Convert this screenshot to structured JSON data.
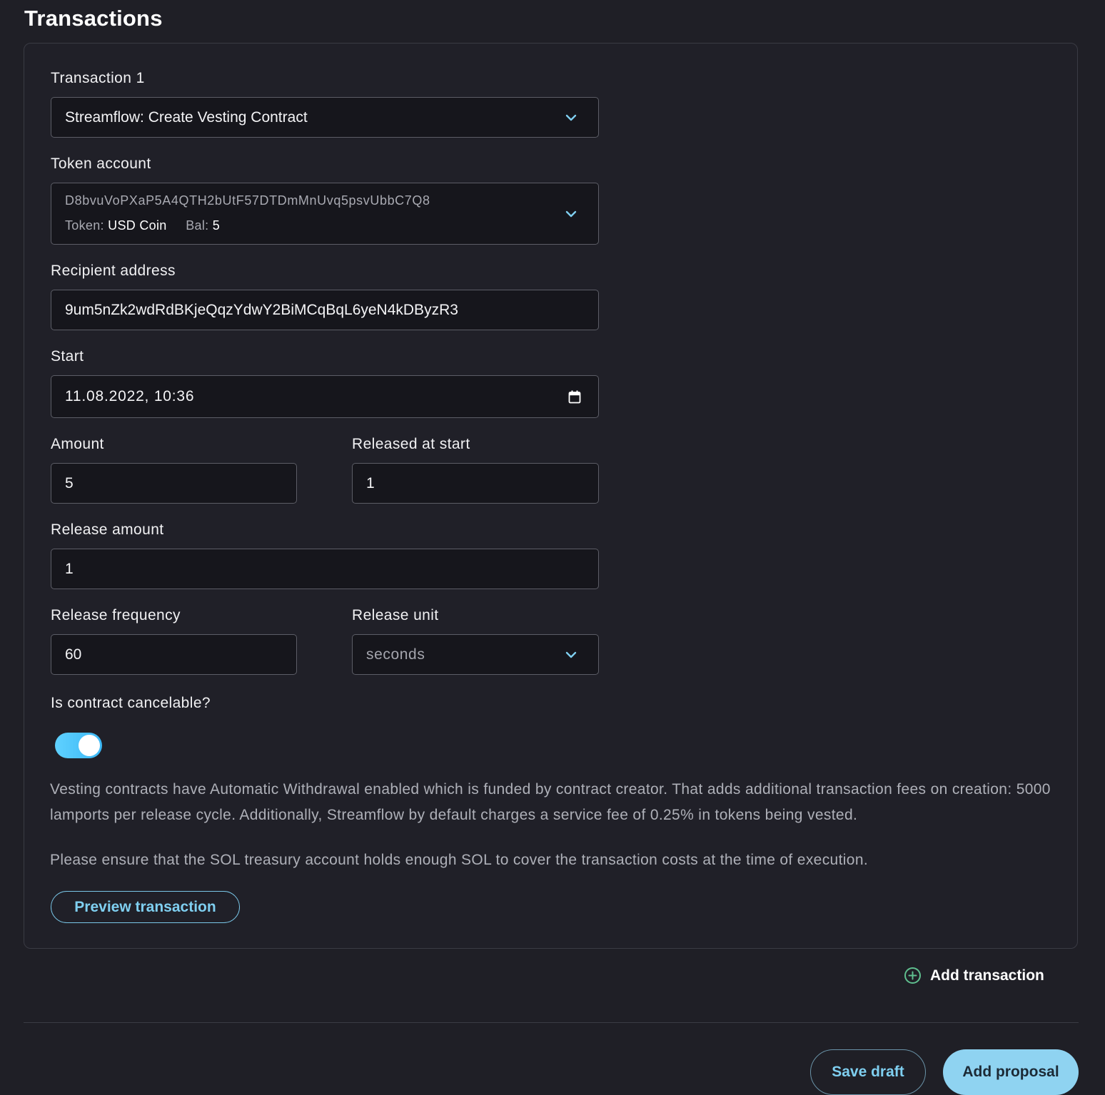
{
  "header": {
    "title": "Transactions"
  },
  "transaction": {
    "heading": "Transaction 1",
    "type_value": "Streamflow: Create Vesting Contract",
    "token_account": {
      "label": "Token account",
      "address": "D8bvuVoPXaP5A4QTH2bUtF57DTDmMnUvq5psvUbbC7Q8",
      "token_label": "Token:",
      "token_value": "USD Coin",
      "bal_label": "Bal:",
      "bal_value": "5"
    },
    "recipient": {
      "label": "Recipient address",
      "value": "9um5nZk2wdRdBKjeQqzYdwY2BiMCqBqL6yeN4kDByzR3"
    },
    "start": {
      "label": "Start",
      "value": "11.08.2022, 10:36"
    },
    "amount": {
      "label": "Amount",
      "value": "5"
    },
    "released_at_start": {
      "label": "Released at start",
      "value": "1"
    },
    "release_amount": {
      "label": "Release amount",
      "value": "1"
    },
    "release_frequency": {
      "label": "Release frequency",
      "value": "60"
    },
    "release_unit": {
      "label": "Release unit",
      "value": "seconds"
    },
    "cancelable": {
      "label": "Is contract cancelable?",
      "enabled": true
    },
    "info_text_1": "Vesting contracts have Automatic Withdrawal enabled which is funded by contract creator. That adds additional transaction fees on creation: 5000 lamports per release cycle. Additionally, Streamflow by default charges a service fee of 0.25% in tokens being vested.",
    "info_text_2": "Please ensure that the SOL treasury account holds enough SOL to cover the transaction costs at the time of execution.",
    "preview_button": "Preview transaction"
  },
  "actions": {
    "add_transaction": "Add transaction",
    "save_draft": "Save draft",
    "add_proposal": "Add proposal"
  },
  "colors": {
    "background": "#1f1f26",
    "accent": "#7fcff0",
    "primary_button": "#8fd3f1",
    "toggle_on": "#3bb7f5",
    "add_icon": "#5fbf8f"
  }
}
